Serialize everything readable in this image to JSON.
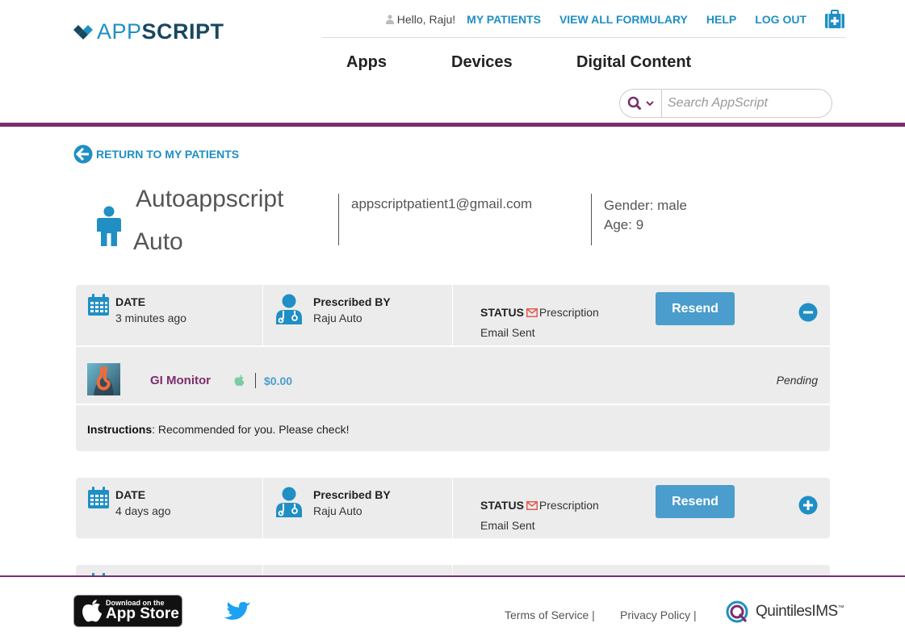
{
  "header": {
    "logo_app": "APP",
    "logo_script": "SCRIPT",
    "greeting": "Hello, Raju!",
    "links": [
      "MY PATIENTS",
      "VIEW ALL FORMULARY",
      "HELP",
      "LOG OUT"
    ],
    "nav": [
      "Apps",
      "Devices",
      "Digital Content"
    ],
    "search_placeholder": "Search AppScript"
  },
  "return_label": "RETURN TO MY PATIENTS",
  "patient": {
    "first_name": "Autoappscript",
    "last_name": "Auto",
    "email": "appscriptpatient1@gmail.com",
    "gender": "Gender: male",
    "age": "Age: 9"
  },
  "prescriptions": [
    {
      "date_label": "DATE",
      "date_value": "3 minutes ago",
      "by_label": "Prescribed BY",
      "by_value": "Raju Auto",
      "status_label": "STATUS",
      "status_value_1": "Prescription",
      "status_value_2": "Email Sent",
      "resend_label": "Resend",
      "expanded": true,
      "item": {
        "name": "GI Monitor",
        "price": "$0.00",
        "state": "Pending"
      },
      "instructions_label": "Instructions",
      "instructions_text": ": Recommended for you. Please check!"
    },
    {
      "date_label": "DATE",
      "date_value": "4 days ago",
      "by_label": "Prescribed BY",
      "by_value": "Raju Auto",
      "status_label": "STATUS",
      "status_value_1": "Prescription",
      "status_value_2": "Email Sent",
      "resend_label": "Resend",
      "expanded": false
    }
  ],
  "footer": {
    "appstore_small": "Download on the",
    "appstore_big": "App Store",
    "terms": "Terms of Service |",
    "privacy": "Privacy Policy |",
    "brand": "QuintilesIMS",
    "brand_tm": "™"
  },
  "colors": {
    "accent_blue": "#1f8fc4",
    "brand_purple": "#7b2d6e",
    "button_blue": "#4a9dcc",
    "card_gray": "#ececec"
  }
}
